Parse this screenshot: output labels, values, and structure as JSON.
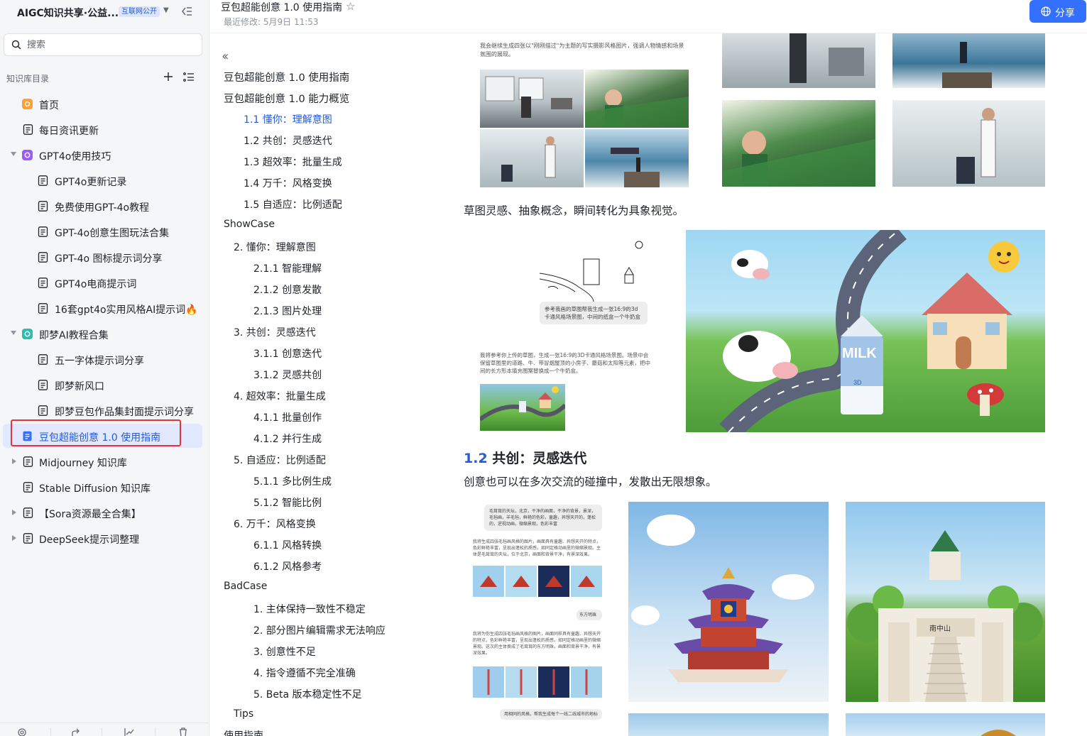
{
  "sidebar": {
    "title": "AIGC知识共享·公益...",
    "badge": "互联网公开",
    "search_placeholder": "搜索",
    "dir_label": "知识库目录",
    "items": [
      {
        "label": "首页",
        "icon": "home-icon"
      },
      {
        "label": "每日资讯更新",
        "icon": "doc-icon"
      },
      {
        "label": "GPT4o使用技巧",
        "icon": "purple-app-icon",
        "expanded": true
      },
      {
        "label": "GPT4o更新记录",
        "icon": "doc-icon"
      },
      {
        "label": "免费使用GPT-4o教程",
        "icon": "doc-icon"
      },
      {
        "label": "GPT-4o创意生图玩法合集",
        "icon": "doc-icon"
      },
      {
        "label": "GPT-4o 图标提示词分享",
        "icon": "doc-icon"
      },
      {
        "label": "GPT4o电商提示词",
        "icon": "doc-icon"
      },
      {
        "label": "16套gpt4o实用风格AI提示词🔥",
        "icon": "doc-icon"
      },
      {
        "label": "即梦AI教程合集",
        "icon": "teal-app-icon",
        "expanded": true
      },
      {
        "label": "五一字体提示词分享",
        "icon": "doc-icon"
      },
      {
        "label": "即梦新风口",
        "icon": "doc-icon"
      },
      {
        "label": "即梦豆包作品集封面提示词分享",
        "icon": "doc-icon"
      },
      {
        "label": "豆包超能创意 1.0 使用指南",
        "icon": "doc-icon",
        "active": true
      },
      {
        "label": "Midjourney 知识库",
        "icon": "doc-icon",
        "collapsed": true
      },
      {
        "label": "Stable Diffusion 知识库",
        "icon": "doc-icon"
      },
      {
        "label": "【Sora资源最全合集】",
        "icon": "doc-icon",
        "collapsed": true
      },
      {
        "label": "DeepSeek提示词整理",
        "icon": "doc-icon",
        "collapsed": true
      }
    ]
  },
  "header": {
    "title": "豆包超能创意 1.0 使用指南",
    "modified": "最近修改: 5月9日 11:53",
    "share_label": "分享"
  },
  "outline": [
    {
      "text": "豆包超能创意 1.0 使用指南"
    },
    {
      "text": "豆包超能创意 1.0 能力概览"
    },
    {
      "text": "1.1 懂你：理解意图",
      "current": true
    },
    {
      "text": "1.2 共创：灵感迭代"
    },
    {
      "text": "1.3 超效率：批量生成"
    },
    {
      "text": "1.4 万千：风格变换"
    },
    {
      "text": "1.5 自适应：比例适配"
    },
    {
      "text": "ShowCase"
    },
    {
      "text": "2. 懂你：理解意图"
    },
    {
      "text": "2.1.1 智能理解"
    },
    {
      "text": "2.1.2 创意发散"
    },
    {
      "text": "2.1.3 图片处理"
    },
    {
      "text": "3. 共创：灵感迭代"
    },
    {
      "text": "3.1.1 创意迭代"
    },
    {
      "text": "3.1.2 灵感共创"
    },
    {
      "text": "4. 超效率：批量生成"
    },
    {
      "text": "4.1.1 批量创作"
    },
    {
      "text": "4.1.2 并行生成"
    },
    {
      "text": "5. 自适应：比例适配"
    },
    {
      "text": "5.1.1 多比例生成"
    },
    {
      "text": "5.1.2 智能比例"
    },
    {
      "text": "6. 万千：风格变换"
    },
    {
      "text": "6.1.1 风格转换"
    },
    {
      "text": "6.1.2 风格参考"
    },
    {
      "text": "BadCase"
    },
    {
      "text": "1. 主体保持一致性不稳定"
    },
    {
      "text": "2. 部分图片编辑需求无法响应"
    },
    {
      "text": "3. 创意性不足"
    },
    {
      "text": "4. 指令遵循不完全准确"
    },
    {
      "text": "5. Beta 版本稳定性不足"
    },
    {
      "text": "Tips"
    },
    {
      "text": "使用指南"
    }
  ],
  "content": {
    "top_caption": "我会继续生成四张以\"刚刚描过\"为主题的写实摄影风格图片，强调人物情感和场景氛围的展现。",
    "sketch_para": "草图灵感、抽象概念，瞬间转化为具象视觉。",
    "sketch_bubble": "参考我画的草图帮我生成一张16:9的3d卡通风格场景图，中间的纸盒一个牛奶盒",
    "sketch_reply": "我将参考你上传的草图，生成一张16:9的3D卡通风格场景图。场景中会保留草图里的道路、牛、带冒烟屋顶的小房子、蘑菇和太阳等元素，把中间的长方形本填充图案替换成一个牛奶盒。",
    "milk_label": "MILK",
    "milk_sub": "3D",
    "section_num": "1.2",
    "section_title": "共创：灵感迭代",
    "cocreate_para": "创意也可以在多次交流的碰撞中，发散出无限想象。",
    "chat_bubble1": "毛茸茸的天坛，北京，干净的画面，干净的背景，景深，毛毡画，羊毛毡，鲜艳的色彩，童趣，异想天开的，蓬松的，逆视动画，微缩景观，色彩丰富",
    "chat_reply1": "我将生成四张毛毡画风格的图片，画面具有童趣、异想天开的特点，色彩鲜艳丰富，呈现出蓬松的质感，如同定格动画里的微缩景观。主体是毛茸茸的天坛，位于北京，画面和背景干净，有景深效果。",
    "chat_tag": "东方明珠",
    "chat_reply2": "我将为你生成四张毛毡画风格的图片，画面同样具有童趣、异想天开的特点，色彩鲜艳丰富，呈现出蓬松的质感，如同定格动画里的微缩景观。这次的主体换成了毛茸茸的东方明珠，画面和背景干净，有景深效果。",
    "chat_bubble2": "用相同的风格，帮我生成每个一线二线城市的地标",
    "gate_label": "南中山"
  }
}
